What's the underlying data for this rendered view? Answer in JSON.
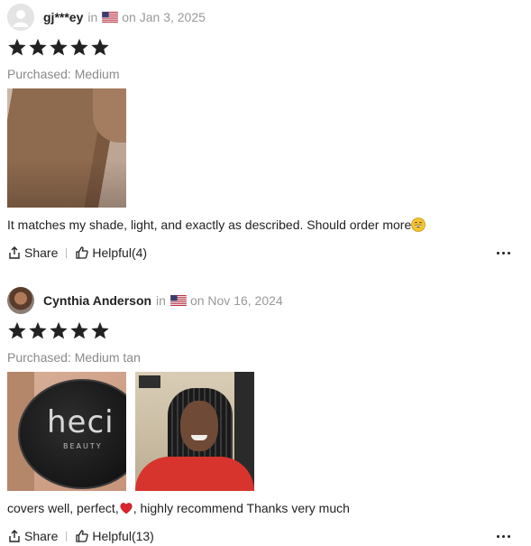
{
  "reviews": [
    {
      "username": "gj***ey",
      "in_text": "in",
      "date_text": "on Jan 3, 2025",
      "rating": 5,
      "purchased": "Purchased: Medium",
      "text": "It matches my shade, light, and exactly as described. Should order more",
      "share_label": "Share",
      "helpful_label": "Helpful(4)"
    },
    {
      "username": "Cynthia Anderson",
      "in_text": "in",
      "date_text": "on Nov 16, 2024",
      "rating": 5,
      "purchased": "Purchased: Medium tan",
      "text_before": "covers well, perfect, ",
      "text_after": ", highly recommend Thanks very much",
      "share_label": "Share",
      "helpful_label": "Helpful(13)",
      "photo_brand": "heci",
      "photo_brand_sub": "BEAUTY"
    }
  ],
  "icons": {
    "avatar_default": "user-avatar-icon",
    "flag": "us-flag-icon",
    "star": "star-icon",
    "share": "share-icon",
    "helpful": "thumbs-up-icon",
    "more": "more-dots-icon",
    "emoji_1": "grinning-face-emoji",
    "emoji_2": "red-heart-emoji"
  },
  "colors": {
    "star": "#222222",
    "meta": "#999999",
    "text": "#222222",
    "purchased": "#8a8a8a"
  }
}
